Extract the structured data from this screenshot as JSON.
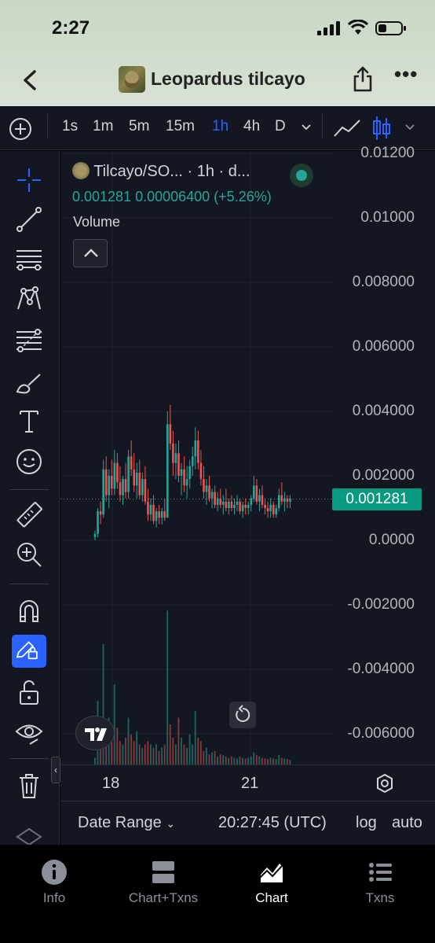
{
  "status_bar": {
    "time": "2:27"
  },
  "nav": {
    "title": "Leopardus tilcayo",
    "back_icon": "chevron-left-icon",
    "share_icon": "share-icon",
    "more_icon": "more-icon"
  },
  "toolbar": {
    "intervals": [
      "1s",
      "1m",
      "5m",
      "15m",
      "1h",
      "4h",
      "D"
    ],
    "active_interval": "1h",
    "accent": "#2962ff"
  },
  "chart": {
    "symbol_line": "Tilcayo/SO... · 1h · d...",
    "ohlc_line": "0.001281 0.00006400 (+5.26%)",
    "volume_label": "Volume",
    "current_price": "0.001281",
    "up_color": "#26a69a",
    "down_color": "#ef5350",
    "y_ticks": [
      "0.01200",
      "0.01000",
      "0.008000",
      "0.006000",
      "0.004000",
      "0.002000",
      "0.0000",
      "-0.002000",
      "-0.004000",
      "-0.006000"
    ],
    "x_ticks": [
      "18",
      "21"
    ]
  },
  "bottom_bar": {
    "date_range": "Date Range",
    "time": "20:27:45 (UTC)",
    "log": "log",
    "auto": "auto"
  },
  "tabs": [
    {
      "label": "Info",
      "icon": "info-icon"
    },
    {
      "label": "Chart+Txns",
      "icon": "split-view-icon"
    },
    {
      "label": "Chart",
      "icon": "chart-icon"
    },
    {
      "label": "Txns",
      "icon": "list-icon"
    }
  ],
  "active_tab": "Chart",
  "chart_data": {
    "type": "candlestick",
    "x_ticks": [
      "18",
      "21"
    ],
    "ylim": [
      -0.007,
      0.012
    ],
    "last_price": 0.001281,
    "candles": [
      [
        0.0001,
        0.0003,
        0.0,
        0.0002
      ],
      [
        0.0002,
        0.001,
        0.0001,
        0.0009
      ],
      [
        0.0009,
        0.0012,
        0.0005,
        0.0008
      ],
      [
        0.0008,
        0.0025,
        0.0007,
        0.0022
      ],
      [
        0.0022,
        0.0026,
        0.0012,
        0.0014
      ],
      [
        0.0014,
        0.0022,
        0.001,
        0.002
      ],
      [
        0.002,
        0.0025,
        0.0014,
        0.0016
      ],
      [
        0.0016,
        0.0028,
        0.0014,
        0.0024
      ],
      [
        0.0024,
        0.0027,
        0.0016,
        0.0018
      ],
      [
        0.0018,
        0.0023,
        0.0012,
        0.0014
      ],
      [
        0.0014,
        0.002,
        0.0011,
        0.0019
      ],
      [
        0.0019,
        0.0024,
        0.0013,
        0.0015
      ],
      [
        0.0015,
        0.0028,
        0.0013,
        0.0026
      ],
      [
        0.0026,
        0.0031,
        0.002,
        0.0022
      ],
      [
        0.0022,
        0.0027,
        0.0015,
        0.0017
      ],
      [
        0.0017,
        0.0024,
        0.0013,
        0.0021
      ],
      [
        0.0021,
        0.0025,
        0.0013,
        0.0014
      ],
      [
        0.0014,
        0.0021,
        0.0012,
        0.0019
      ],
      [
        0.0019,
        0.0023,
        0.0011,
        0.0012
      ],
      [
        0.0012,
        0.0016,
        0.0006,
        0.0008
      ],
      [
        0.0008,
        0.0013,
        0.0006,
        0.0011
      ],
      [
        0.0011,
        0.0014,
        0.0005,
        0.0006
      ],
      [
        0.0006,
        0.001,
        0.0004,
        0.0009
      ],
      [
        0.0009,
        0.0011,
        0.0005,
        0.0007
      ],
      [
        0.0007,
        0.001,
        0.0005,
        0.0009
      ],
      [
        0.0009,
        0.0013,
        0.0006,
        0.0007
      ],
      [
        0.0007,
        0.004,
        0.0007,
        0.0036
      ],
      [
        0.0036,
        0.0042,
        0.0028,
        0.003
      ],
      [
        0.003,
        0.0034,
        0.002,
        0.0024
      ],
      [
        0.0024,
        0.003,
        0.0019,
        0.0027
      ],
      [
        0.0027,
        0.0031,
        0.0018,
        0.002
      ],
      [
        0.002,
        0.0024,
        0.0014,
        0.0022
      ],
      [
        0.0022,
        0.0026,
        0.0015,
        0.0017
      ],
      [
        0.0017,
        0.0023,
        0.0013,
        0.0019
      ],
      [
        0.0019,
        0.0025,
        0.0016,
        0.0023
      ],
      [
        0.0023,
        0.0029,
        0.002,
        0.0026
      ],
      [
        0.0026,
        0.0035,
        0.0022,
        0.0031
      ],
      [
        0.0031,
        0.0034,
        0.0022,
        0.0024
      ],
      [
        0.0024,
        0.0028,
        0.0017,
        0.0019
      ],
      [
        0.0019,
        0.0023,
        0.0013,
        0.0015
      ],
      [
        0.0015,
        0.0019,
        0.0011,
        0.0017
      ],
      [
        0.0017,
        0.002,
        0.0012,
        0.0013
      ],
      [
        0.0013,
        0.0016,
        0.001,
        0.0015
      ],
      [
        0.0015,
        0.0017,
        0.001,
        0.0011
      ],
      [
        0.0011,
        0.0015,
        0.0009,
        0.0013
      ],
      [
        0.0013,
        0.0016,
        0.001,
        0.0011
      ],
      [
        0.0011,
        0.0014,
        0.0008,
        0.0012
      ],
      [
        0.0012,
        0.0016,
        0.0009,
        0.001
      ],
      [
        0.001,
        0.0013,
        0.0008,
        0.0012
      ],
      [
        0.0012,
        0.0014,
        0.0009,
        0.001
      ],
      [
        0.001,
        0.0013,
        0.0008,
        0.0011
      ],
      [
        0.0011,
        0.0014,
        0.0009,
        0.0012
      ],
      [
        0.0012,
        0.0013,
        0.0008,
        0.0009
      ],
      [
        0.0009,
        0.0012,
        0.0007,
        0.0011
      ],
      [
        0.0011,
        0.0013,
        0.0008,
        0.001
      ],
      [
        0.001,
        0.0012,
        0.0008,
        0.0011
      ],
      [
        0.0011,
        0.0014,
        0.0009,
        0.0013
      ],
      [
        0.0013,
        0.002,
        0.0012,
        0.0017
      ],
      [
        0.0017,
        0.0019,
        0.0011,
        0.0012
      ],
      [
        0.0012,
        0.0016,
        0.0009,
        0.0014
      ],
      [
        0.0014,
        0.0017,
        0.001,
        0.0011
      ],
      [
        0.0011,
        0.0013,
        0.0008,
        0.001
      ],
      [
        0.001,
        0.0012,
        0.0007,
        0.0009
      ],
      [
        0.0009,
        0.0013,
        0.0007,
        0.0011
      ],
      [
        0.0011,
        0.0012,
        0.0007,
        0.0008
      ],
      [
        0.0008,
        0.0011,
        0.0007,
        0.001
      ],
      [
        0.001,
        0.0016,
        0.0009,
        0.0014
      ],
      [
        0.0014,
        0.0018,
        0.0011,
        0.0012
      ],
      [
        0.0012,
        0.0015,
        0.0009,
        0.0013
      ],
      [
        0.0013,
        0.0014,
        0.001,
        0.0012
      ],
      [
        0.0012,
        0.0014,
        0.001,
        0.0013
      ]
    ],
    "volumes": [
      10,
      95,
      40,
      180,
      60,
      70,
      40,
      120,
      55,
      35,
      30,
      40,
      70,
      45,
      35,
      50,
      30,
      25,
      30,
      35,
      30,
      25,
      30,
      20,
      25,
      30,
      230,
      60,
      40,
      30,
      70,
      40,
      30,
      25,
      45,
      30,
      80,
      40,
      35,
      20,
      25,
      15,
      18,
      20,
      12,
      15,
      14,
      12,
      10,
      12,
      10,
      9,
      12,
      10,
      9,
      10,
      12,
      18,
      14,
      12,
      10,
      9,
      8,
      10,
      9,
      8,
      14,
      10,
      9,
      8,
      7
    ]
  }
}
